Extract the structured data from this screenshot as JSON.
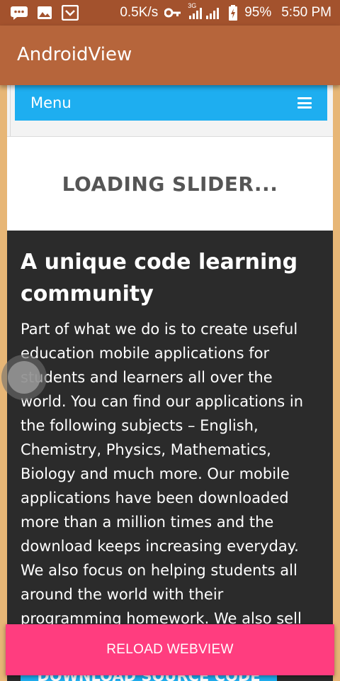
{
  "status_bar": {
    "notification_icons": [
      "message-icon",
      "image-icon",
      "download-box-icon"
    ],
    "net_speed": "0.5K/s",
    "network_label": "3G",
    "battery": "95%",
    "time": "5:50 PM"
  },
  "app_bar": {
    "title": "AndroidView"
  },
  "site": {
    "menu_label": "Menu",
    "slider_text": "LOADING SLIDER...",
    "heading": "A unique code learning community",
    "body": "Part of what we do is to create useful education mobile applications for students and learners all over the world. You can find our applications in the following subjects – English, Chemistry, Physics, Mathematics, Biology and much more. Our mobile applications have been downloaded more than a million times and the download keeps increasing everyday. We also focus on helping students all around the world with their programming homework. We also sell app source code.",
    "download_button": "DOWNLOAD SOURCE CODE"
  },
  "reload_button": "RELOAD WEBVIEW",
  "colors": {
    "status_bar": "#a3522d",
    "app_bar": "#b6653b",
    "menu_bar": "#1eaef0",
    "dark_section": "#2b2b2b",
    "reload_button": "#ff3d7f"
  }
}
